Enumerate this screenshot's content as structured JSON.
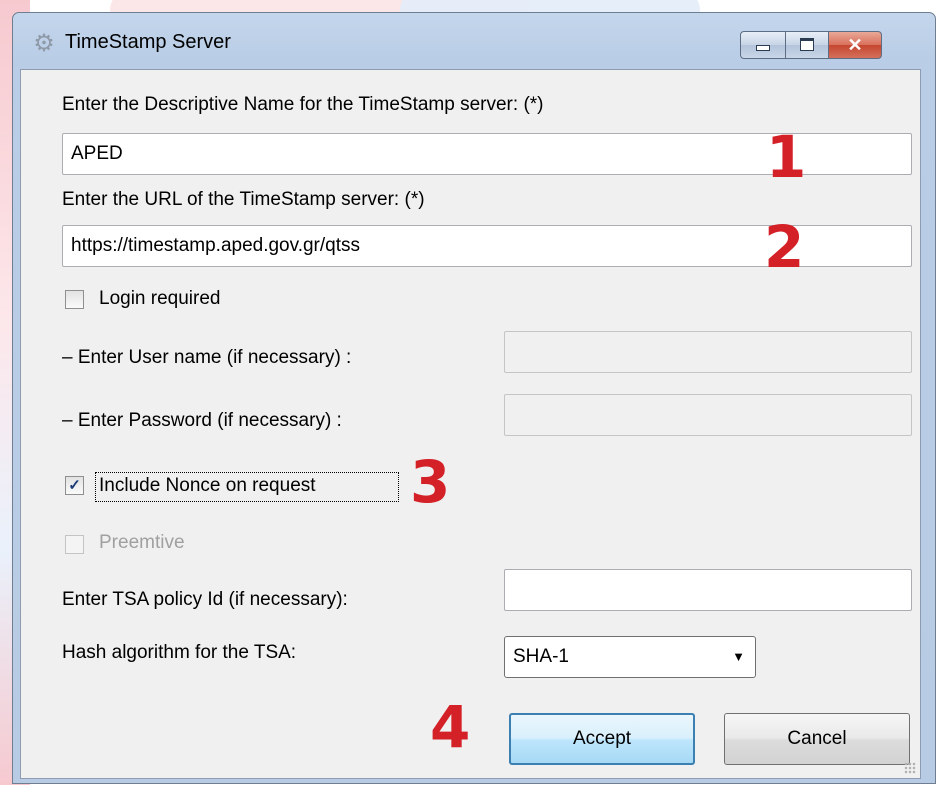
{
  "window": {
    "title": "TimeStamp Server",
    "icon": "gear-icon",
    "controls": {
      "minimize": "minimize-icon",
      "maximize": "maximize-icon",
      "close": "✕"
    }
  },
  "form": {
    "name_label": "Enter the Descriptive Name for the TimeStamp server: (*)",
    "name_value": "APED",
    "url_label": "Enter the URL of the TimeStamp server: (*)",
    "url_value": "https://timestamp.aped.gov.gr/qtss",
    "login_required_label": "Login required",
    "login_required_checked": false,
    "username_label": "– Enter User name (if necessary) :",
    "username_value": "",
    "password_label": "– Enter Password (if necessary) :",
    "password_value": "",
    "nonce_label": "Include Nonce on request",
    "nonce_checked": true,
    "preemptive_label": "Preemtive",
    "preemptive_checked": false,
    "policy_label": "Enter TSA policy Id (if necessary):",
    "policy_value": "",
    "hash_label": "Hash algorithm for the TSA:",
    "hash_value": "SHA-1"
  },
  "buttons": {
    "accept": "Accept",
    "cancel": "Cancel"
  },
  "annotations": [
    "1",
    "2",
    "3",
    "4"
  ],
  "colors": {
    "annotation": "#d42027",
    "titlebar": "#b9cde6",
    "default_button_border": "#3c7fb1"
  }
}
